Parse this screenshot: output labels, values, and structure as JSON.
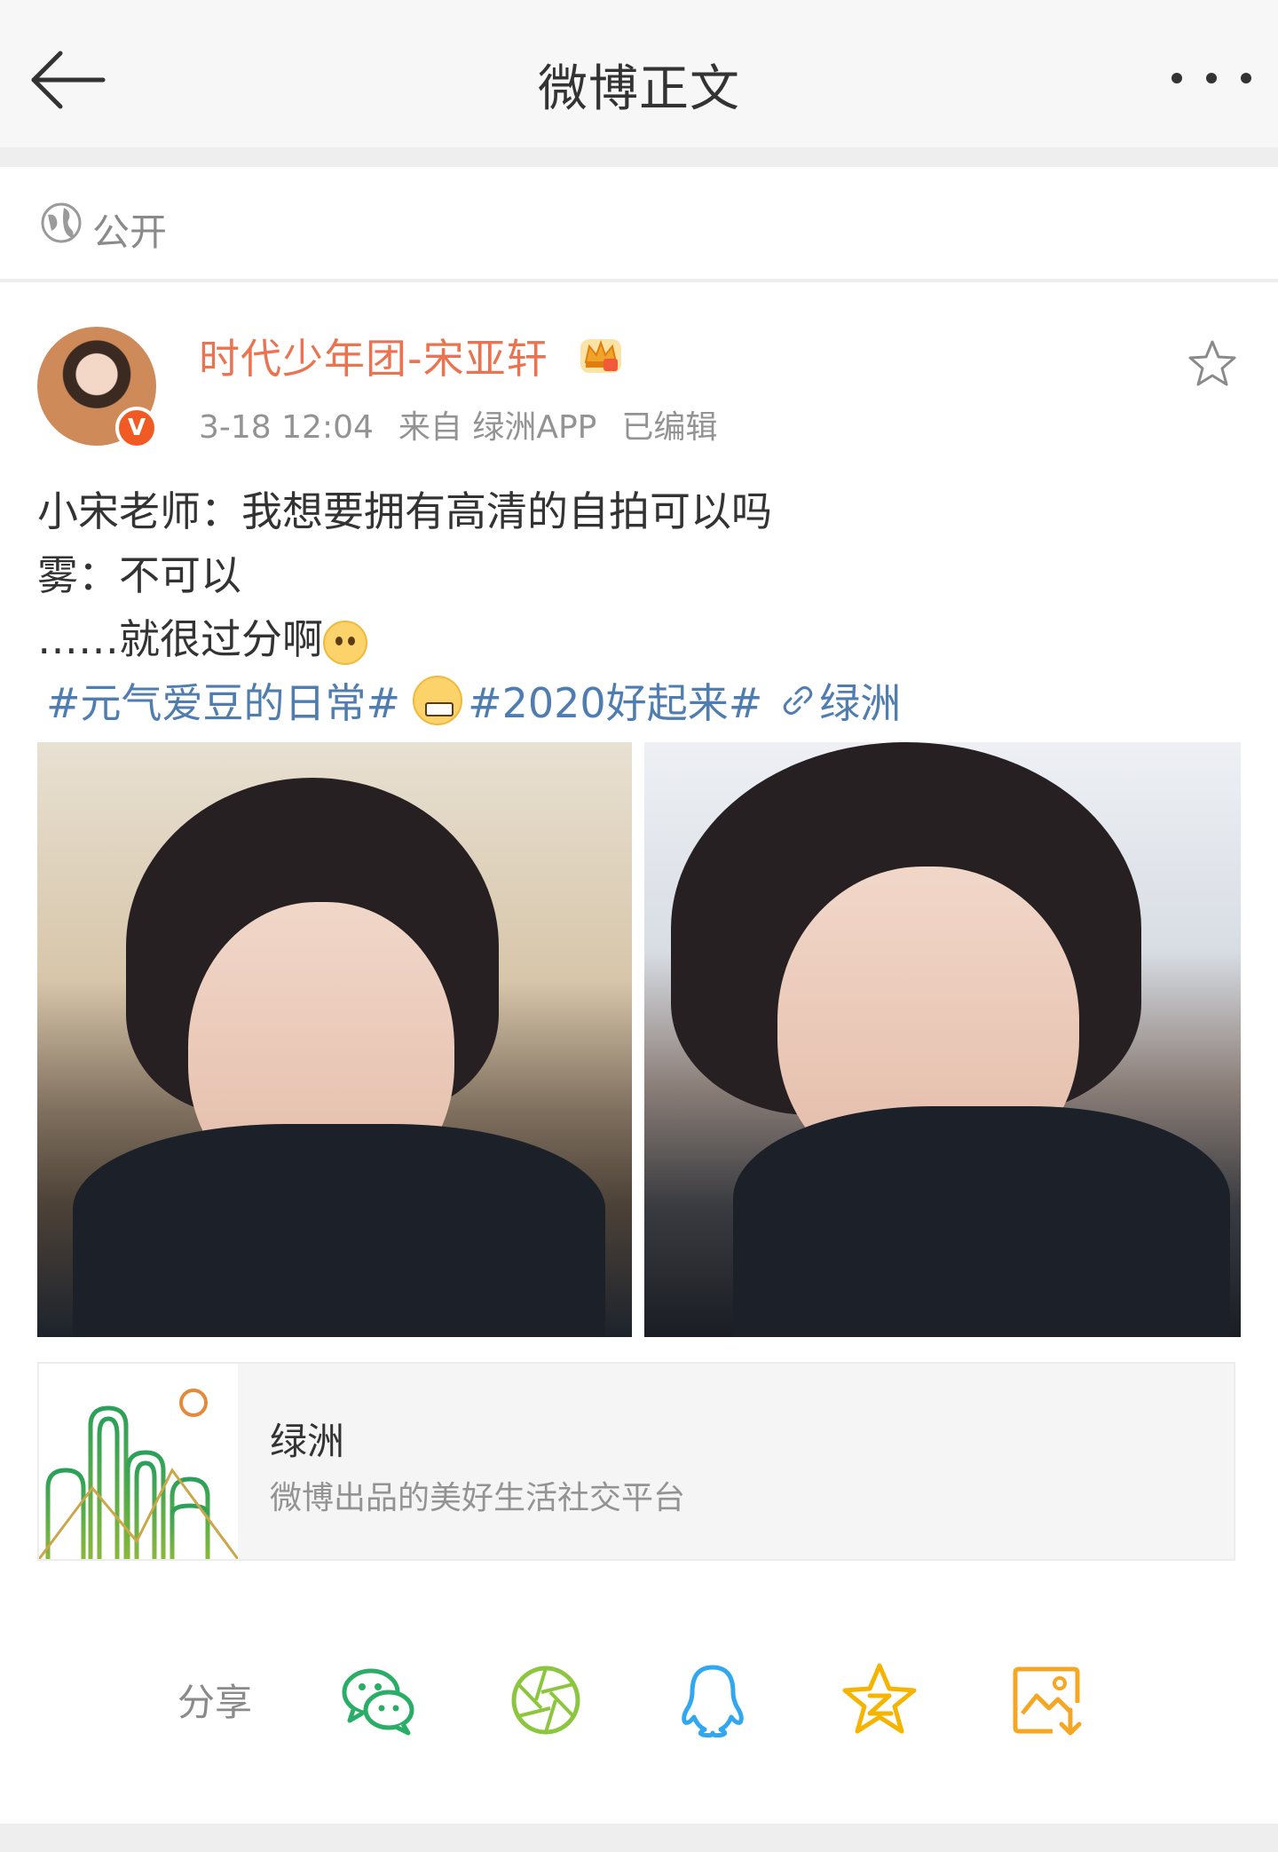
{
  "header": {
    "title": "微博正文"
  },
  "visibility": {
    "label": "公开"
  },
  "post": {
    "username": "时代少年团-宋亚轩",
    "time": "3-18 12:04",
    "source": "来自 绿洲APP",
    "edited": "已编辑",
    "lines": [
      "小宋老师：我想要拥有高清的自拍可以吗",
      "雾：不可以",
      "……就很过分啊"
    ],
    "tags": {
      "tag1": "#元气爱豆的日常#",
      "tag2": "#2020好起来#",
      "link": "绿洲"
    }
  },
  "card": {
    "title": "绿洲",
    "description": "微博出品的美好生活社交平台"
  },
  "share": {
    "label": "分享"
  },
  "colors": {
    "username": "#eb7350",
    "link": "#507daf",
    "wechat": "#2aae67",
    "moments": "#8cc63f",
    "qq": "#30a7ef",
    "qzone": "#f5b400",
    "save": "#f5a623"
  }
}
